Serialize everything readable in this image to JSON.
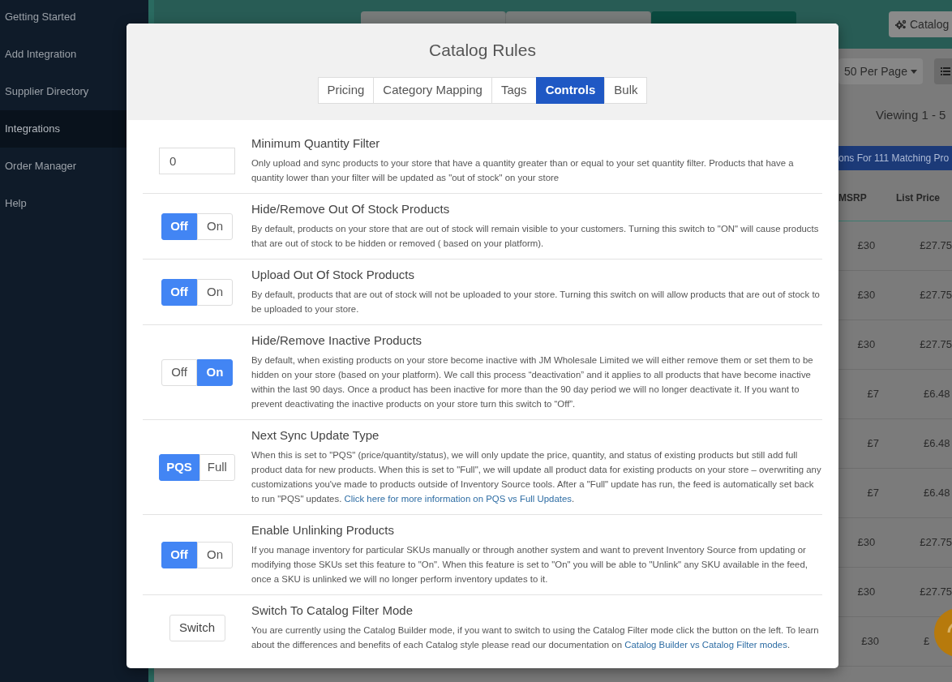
{
  "sidebar": {
    "items": [
      {
        "label": "Getting Started",
        "selected": false
      },
      {
        "label": "Add Integration",
        "selected": false
      },
      {
        "label": "Supplier Directory",
        "selected": false
      },
      {
        "label": "Integrations",
        "selected": true
      },
      {
        "label": "Order Manager",
        "selected": false
      },
      {
        "label": "Help",
        "selected": false
      }
    ]
  },
  "header": {
    "tabs": [
      {
        "selected": false
      },
      {
        "selected": false
      },
      {
        "selected": true
      }
    ],
    "catalog_button": "Catalog"
  },
  "toolbar": {
    "per_page": "50 Per Page",
    "viewing": "Viewing 1 - 5"
  },
  "banner": "ons For 111 Matching Pro",
  "table": {
    "columns": [
      "MSRP",
      "List Price"
    ],
    "rows": [
      [
        "£30",
        "£27.75"
      ],
      [
        "£30",
        "£27.75"
      ],
      [
        "£30",
        "£27.75"
      ],
      [
        "£7",
        "£6.48"
      ],
      [
        "£7",
        "£6.48"
      ],
      [
        "£7",
        "£6.48"
      ],
      [
        "£30",
        "£27.75"
      ],
      [
        "£30",
        "£27.75"
      ],
      [
        "£30",
        "£"
      ]
    ]
  },
  "modal": {
    "title": "Catalog Rules",
    "tabs": [
      {
        "label": "Pricing",
        "selected": false
      },
      {
        "label": "Category Mapping",
        "selected": false
      },
      {
        "label": "Tags",
        "selected": false
      },
      {
        "label": "Controls",
        "selected": true
      },
      {
        "label": "Bulk",
        "selected": false
      }
    ],
    "settings": [
      {
        "kind": "input",
        "value": "0",
        "title": "Minimum Quantity Filter",
        "description": "Only upload and sync products to your store that have a quantity greater than or equal to your set quantity filter. Products that have a quantity lower than your filter will be updated as \"out of stock\" on your store"
      },
      {
        "kind": "toggle",
        "options": [
          {
            "label": "Off",
            "selected": true
          },
          {
            "label": "On",
            "selected": false
          }
        ],
        "title": "Hide/Remove Out Of Stock Products",
        "description": "By default, products on your store that are out of stock will remain visible to your customers. Turning this switch to \"ON\" will cause products that are out of stock to be hidden or removed ( based on your platform)."
      },
      {
        "kind": "toggle",
        "options": [
          {
            "label": "Off",
            "selected": true
          },
          {
            "label": "On",
            "selected": false
          }
        ],
        "title": "Upload Out Of Stock Products",
        "description": "By default, products that are out of stock will not be uploaded to your store. Turning this switch on will allow products that are out of stock to be uploaded to your store."
      },
      {
        "kind": "toggle",
        "options": [
          {
            "label": "Off",
            "selected": false
          },
          {
            "label": "On",
            "selected": true
          }
        ],
        "title": "Hide/Remove Inactive Products",
        "description": "By default, when existing products on your store become inactive with JM Wholesale Limited we will either remove them or set them to be hidden on your store (based on your platform). We call this process “deactivation” and it applies to all products that have become inactive within the last 90 days. Once a product has been inactive for more than the 90 day period we will no longer deactivate it. If you want to prevent deactivating the inactive products on your store turn this switch to “Off”."
      },
      {
        "kind": "toggle",
        "options": [
          {
            "label": "PQS",
            "selected": true
          },
          {
            "label": "Full",
            "selected": false
          }
        ],
        "title": "Next Sync Update Type",
        "description": "When this is set to \"PQS\" (price/quantity/status), we will only update the price, quantity, and status of existing products but still add full product data for new products. When this is set to \"Full\", we will update all product data for existing products on your store – overwriting any customizations you've made to products outside of Inventory Source tools. After a \"Full\" update has run, the feed is automatically set back to run \"PQS\" updates.",
        "link": "Click here for more information on PQS vs Full Updates",
        "after_link": "."
      },
      {
        "kind": "toggle",
        "options": [
          {
            "label": "Off",
            "selected": true
          },
          {
            "label": "On",
            "selected": false
          }
        ],
        "title": "Enable Unlinking Products",
        "description": "If you manage inventory for particular SKUs manually or through another system and want to prevent Inventory Source from updating or modifying those SKUs set this feature to \"On\". When this feature is set to \"On\" you will be able to \"Unlink\" any SKU available in the feed, once a SKU is unlinked we will no longer perform inventory updates to it."
      },
      {
        "kind": "button",
        "button": "Switch",
        "title": "Switch To Catalog Filter Mode",
        "description": "You are currently using the Catalog Builder mode, if you want to switch to using the Catalog Filter mode click the button on the left. To learn about the differences and benefits of each Catalog style please read our documentation on",
        "link": "Catalog Builder vs Catalog Filter modes",
        "after_link": "."
      }
    ]
  }
}
